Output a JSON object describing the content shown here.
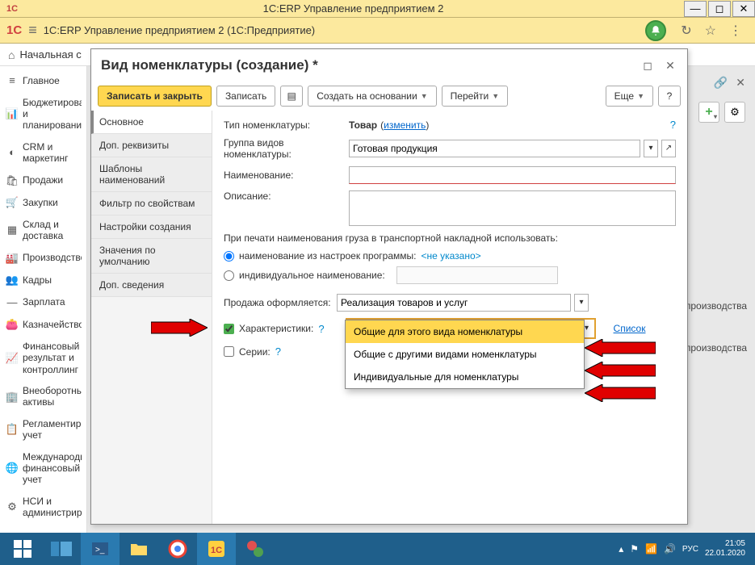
{
  "titlebar": {
    "title": "1С:ERP Управление предприятием 2"
  },
  "header2": {
    "apptitle": "1C:ERP Управление предприятием 2  (1С:Предприятие)"
  },
  "breadcrumb": {
    "text": "Начальная с"
  },
  "sidebar": {
    "items": [
      {
        "icon": "≡",
        "label": "Главное"
      },
      {
        "icon": "📊",
        "label": "Бюджетирование и планирование"
      },
      {
        "icon": "◐",
        "label": "CRM и маркетинг"
      },
      {
        "icon": "🛍",
        "label": "Продажи"
      },
      {
        "icon": "🛒",
        "label": "Закупки"
      },
      {
        "icon": "▦",
        "label": "Склад и доставка"
      },
      {
        "icon": "🏭",
        "label": "Производство"
      },
      {
        "icon": "👥",
        "label": "Кадры"
      },
      {
        "icon": "—",
        "label": "Зарплата"
      },
      {
        "icon": "👛",
        "label": "Казначейство"
      },
      {
        "icon": "📈",
        "label": "Финансовый результат и контроллинг"
      },
      {
        "icon": "🏢",
        "label": "Внеоборотные активы"
      },
      {
        "icon": "📋",
        "label": "Регламентированный учет"
      },
      {
        "icon": "🌐",
        "label": "Международный финансовый учет"
      },
      {
        "icon": "⚙",
        "label": "НСИ и администрирование"
      }
    ]
  },
  "bgrows": {
    "r1": "производства",
    "r2": "производства"
  },
  "popup": {
    "title": "Вид номенклатуры (создание) *",
    "toolbar": {
      "save_close": "Записать и закрыть",
      "save": "Записать",
      "create_based": "Создать на основании",
      "goto": "Перейти",
      "more": "Еще",
      "help": "?"
    },
    "nav": [
      "Основное",
      "Доп. реквизиты",
      "Шаблоны наименований",
      "Фильтр по свойствам",
      "Настройки создания",
      "Значения по умолчанию",
      "Доп. сведения"
    ],
    "form": {
      "type_label": "Тип номенклатуры:",
      "type_value": "Товар",
      "type_change": "изменить",
      "group_label": "Группа видов номенклатуры:",
      "group_value": "Готовая продукция",
      "name_label": "Наименование:",
      "desc_label": "Описание:",
      "print_text": "При печати наименования груза в транспортной накладной использовать:",
      "radio1": "наименование из настроек программы:",
      "radio1_hint": "<не указано>",
      "radio2": "индивидуальное наименование:",
      "sale_label": "Продажа оформляется:",
      "sale_value": "Реализация товаров и услуг",
      "chars_label": "Характеристики:",
      "chars_value": "Общие для этого вида номенклатуры",
      "chars_link": "Список",
      "series_label": "Серии:",
      "dropdown": [
        "Общие для этого вида номенклатуры",
        "Общие с другими видами номенклатуры",
        "Индивидуальные для номенклатуры"
      ]
    }
  },
  "taskbar": {
    "lang": "РУС",
    "time": "21:05",
    "date": "22.01.2020"
  }
}
